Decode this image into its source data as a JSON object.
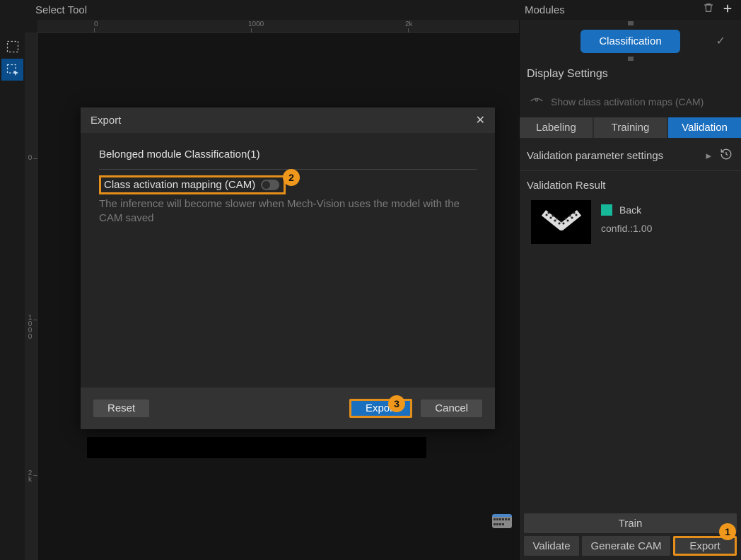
{
  "top": {
    "left_title": "Select Tool",
    "right_title": "Modules"
  },
  "module": {
    "pill_label": "Classification"
  },
  "display_settings": {
    "header": "Display Settings",
    "cam_toggle_label": "Show class activation maps (CAM)"
  },
  "tabs": {
    "labeling": "Labeling",
    "training": "Training",
    "validation": "Validation"
  },
  "validation": {
    "param_settings": "Validation parameter settings",
    "result_header": "Validation Result",
    "result": {
      "class_label": "Back",
      "confidence": "confid.:1.00"
    }
  },
  "bottom": {
    "train": "Train",
    "validate": "Validate",
    "generate_cam": "Generate CAM",
    "export": "Export"
  },
  "dialog": {
    "title": "Export",
    "belonged": "Belonged module Classification(1)",
    "cam_label": "Class activation mapping (CAM)",
    "cam_note": "The inference will become slower when Mech-Vision uses the model with the CAM saved",
    "reset": "Reset",
    "export": "Export",
    "cancel": "Cancel"
  },
  "callouts": {
    "c1": "1",
    "c2": "2",
    "c3": "3"
  },
  "ruler": {
    "h0": "0",
    "h1000": "1000",
    "h2k": "2k",
    "v0": "0",
    "v1000": "1000",
    "v2k": "2k"
  }
}
